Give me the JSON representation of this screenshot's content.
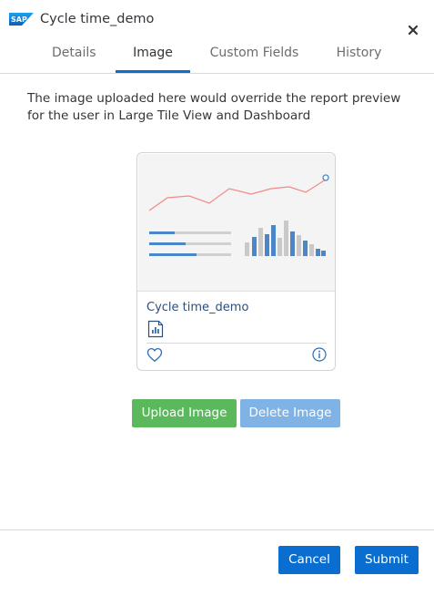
{
  "header": {
    "logo_text": "SAP",
    "title": "Cycle time_demo",
    "close_icon": "close-icon"
  },
  "tabs": [
    {
      "label": "Details",
      "active": false
    },
    {
      "label": "Image",
      "active": true
    },
    {
      "label": "Custom Fields",
      "active": false
    },
    {
      "label": "History",
      "active": false
    }
  ],
  "description": "The image uploaded here would override the report preview for the user in Large Tile View and Dashboard",
  "card": {
    "title": "Cycle time_demo",
    "icons": [
      "report-chart-icon",
      "heart-icon",
      "info-icon"
    ]
  },
  "buttons": {
    "upload": "Upload Image",
    "delete": "Delete Image",
    "cancel": "Cancel",
    "submit": "Submit"
  },
  "colors": {
    "accent": "#0a6ed1",
    "upload_button": "#5cb85c",
    "delete_button": "#7fb2e5",
    "card_title": "#2c4f7b"
  }
}
